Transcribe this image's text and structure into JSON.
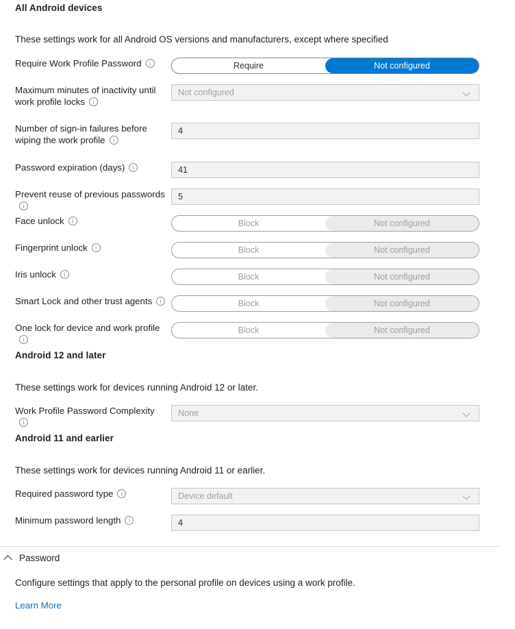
{
  "sections": [
    {
      "title": "All Android devices",
      "description": "These settings work for all Android OS versions and manufacturers, except where specified",
      "rows": [
        {
          "label": "Require Work Profile Password",
          "info": "info-icon",
          "control": "toggle",
          "options": [
            "Require",
            "Not configured"
          ],
          "selected": "Not configured",
          "state": "enabled"
        },
        {
          "label": "Maximum minutes of inactivity until work profile locks",
          "info": "info-icon",
          "control": "dropdown",
          "value": "Not configured",
          "state": "disabled"
        },
        {
          "label": "Number of sign-in failures before wiping the work profile",
          "info": "info-icon",
          "control": "input",
          "value": "4",
          "state": "enabled"
        },
        {
          "label": "Password expiration (days)",
          "info": "info-icon",
          "control": "input",
          "value": "41",
          "state": "enabled"
        },
        {
          "label": "Prevent reuse of previous passwords",
          "info": "info-icon",
          "control": "input",
          "value": "5",
          "state": "enabled"
        },
        {
          "label": "Face unlock",
          "info": "info-icon",
          "control": "toggle",
          "options": [
            "Block",
            "Not configured"
          ],
          "selected": "Not configured",
          "state": "disabled"
        },
        {
          "label": "Fingerprint unlock",
          "info": "info-icon",
          "control": "toggle",
          "options": [
            "Block",
            "Not configured"
          ],
          "selected": "Not configured",
          "state": "disabled"
        },
        {
          "label": "Iris unlock",
          "info": "info-icon",
          "control": "toggle",
          "options": [
            "Block",
            "Not configured"
          ],
          "selected": "Not configured",
          "state": "disabled"
        },
        {
          "label": "Smart Lock and other trust agents",
          "info": "info-icon",
          "control": "toggle",
          "options": [
            "Block",
            "Not configured"
          ],
          "selected": "Not configured",
          "state": "disabled"
        },
        {
          "label": "One lock for device and work profile",
          "info": "info-icon",
          "control": "toggle",
          "options": [
            "Block",
            "Not configured"
          ],
          "selected": "Not configured",
          "state": "disabled"
        }
      ]
    },
    {
      "title": "Android 12 and later",
      "description": "These settings work for devices running Android 12 or later.",
      "rows": [
        {
          "label": "Work Profile Password Complexity",
          "info": "info-icon",
          "control": "dropdown",
          "value": "None",
          "state": "disabled"
        }
      ]
    },
    {
      "title": "Android 11 and earlier",
      "description": "These settings work for devices running Android 11 or earlier.",
      "rows": [
        {
          "label": "Required password type",
          "info": "info-icon",
          "control": "dropdown",
          "value": "Device default",
          "state": "disabled"
        },
        {
          "label": "Minimum password length",
          "info": "info-icon",
          "control": "input",
          "value": "4",
          "state": "enabled"
        }
      ]
    }
  ],
  "footer": {
    "collapse_icon": "chevron-up-icon",
    "title": "Password",
    "description": "Configure settings that apply to the personal profile on devices using a work profile.",
    "link_label": "Learn More"
  },
  "colors": {
    "accent": "#0078d4",
    "link": "#0f6cbd",
    "field_bg": "#f3f2f1",
    "field_border": "#c8c6c4",
    "disabled_text": "#a19f9d",
    "text": "#201f1e",
    "divider": "#e1dfdd"
  }
}
